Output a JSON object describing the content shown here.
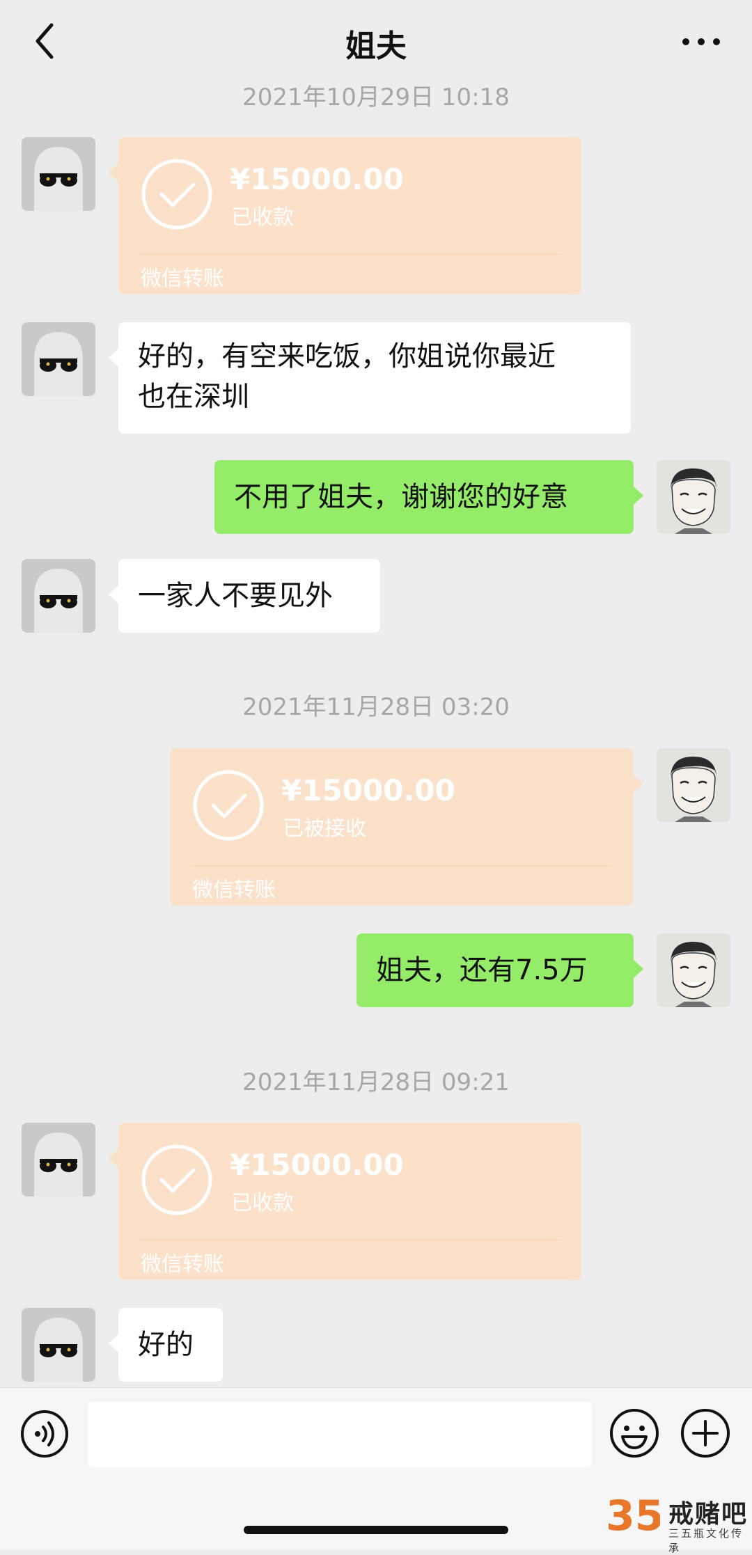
{
  "header": {
    "title": "姐夫"
  },
  "messages": {
    "t1": "2021年10月29日 10:18",
    "m1": {
      "amount": "¥15000.00",
      "status": "已收款",
      "footer": "微信转账"
    },
    "m2": {
      "line1": "好的，有空来吃饭，你姐说你最近",
      "line2": "也在深圳"
    },
    "m3": "不用了姐夫，谢谢您的好意",
    "m4": "一家人不要见外",
    "t2": "2021年11月28日 03:20",
    "m5": {
      "amount": "¥15000.00",
      "status": "已被接收",
      "footer": "微信转账"
    },
    "m6": "姐夫，还有7.5万",
    "t3": "2021年11月28日 09:21",
    "m7": {
      "amount": "¥15000.00",
      "status": "已收款",
      "footer": "微信转账"
    },
    "m8": "好的"
  },
  "input": {
    "value": ""
  },
  "watermark": {
    "logo_text": "35",
    "name": "戒赌吧",
    "sub": "三五瓶文化传承"
  },
  "colors": {
    "background": "#ededed",
    "sent_bubble": "#95ec69",
    "received_bubble": "#ffffff",
    "transfer_card": "#fbe1c9"
  },
  "icons": [
    "back-icon",
    "more-icon",
    "check-circle-icon",
    "voice-icon",
    "emoji-icon",
    "plus-icon"
  ]
}
